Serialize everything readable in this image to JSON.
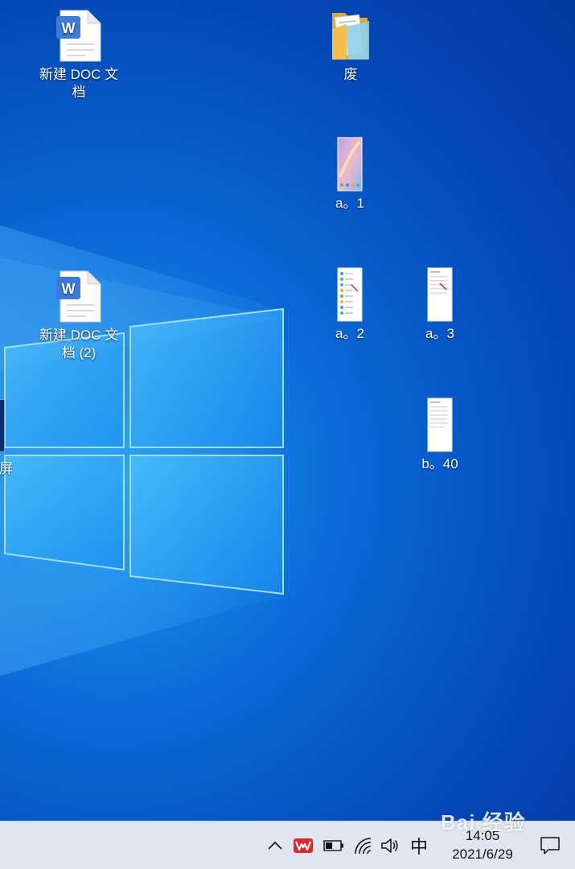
{
  "desktop": {
    "icons": [
      {
        "name": "doc-icon",
        "label": "新建 DOC 文档",
        "type": "word"
      },
      {
        "name": "folder-icon",
        "label": "废",
        "type": "folder"
      },
      {
        "name": "image-file-icon",
        "label": "a。1",
        "type": "image-wallpaper"
      },
      {
        "name": "doc-icon",
        "label": "新建 DOC 文档 (2)",
        "type": "word"
      },
      {
        "name": "image-file-icon",
        "label": "a。2",
        "type": "image-list"
      },
      {
        "name": "image-file-icon",
        "label": "a。3",
        "type": "image-page"
      },
      {
        "name": "image-file-icon",
        "label": "b。40",
        "type": "image-page"
      }
    ],
    "edge_label": "屏"
  },
  "taskbar": {
    "ime_label": "中",
    "time": "14:05",
    "date": "2021/6/29",
    "tray_icons": [
      "chevron-up-icon",
      "wps-icon",
      "battery-icon",
      "wifi-icon",
      "volume-icon"
    ],
    "notification_icon": "notification-icon"
  },
  "watermark": {
    "text": "Bai 经验"
  },
  "colors": {
    "wallpaper_blue": "#0a6ad8",
    "taskbar_bg": "#dfe6ef",
    "wps_red": "#e0252b",
    "word_blue": "#3d7bd8",
    "folder_yellow": "#f2c04a"
  }
}
